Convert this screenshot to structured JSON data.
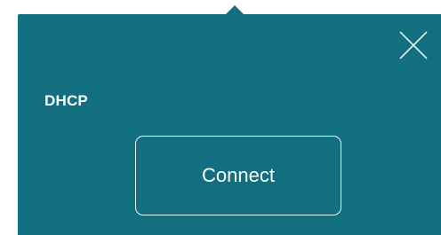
{
  "panel": {
    "title": "DHCP",
    "connect_label": "Connect",
    "close_icon": "close-icon"
  },
  "colors": {
    "panel_background": "#126f7f",
    "text": "#ffffff",
    "button_border": "#e8f2f4",
    "page_background": "#ffffff"
  }
}
